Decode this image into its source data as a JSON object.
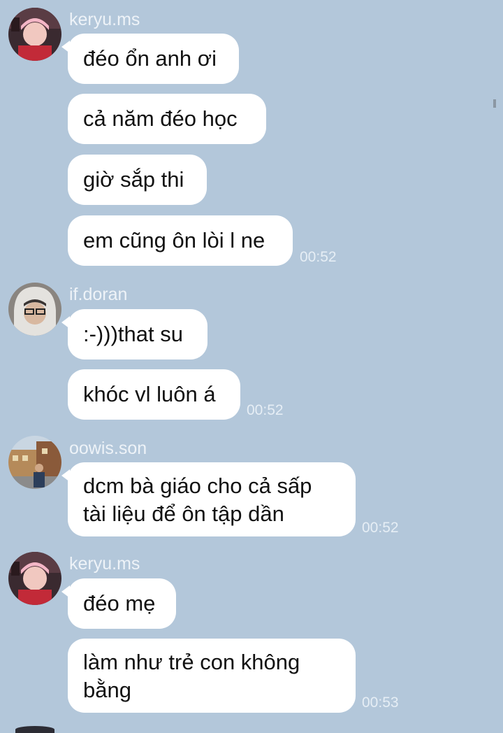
{
  "messages": [
    {
      "sender": "keryu.ms",
      "avatar": "avatar-keryu",
      "lines": [
        "đéo ổn anh ơi",
        "cả năm đéo học",
        "giờ sắp thi",
        "em cũng ôn lòi l ne"
      ],
      "time": "00:52"
    },
    {
      "sender": "if.doran",
      "avatar": "avatar-doran",
      "lines": [
        ":-)))that su",
        "khóc vl luôn á"
      ],
      "time": "00:52"
    },
    {
      "sender": "oowis.son",
      "avatar": "avatar-oowis",
      "lines": [
        "dcm bà giáo cho cả sấp\ntài liệu để ôn tập dần"
      ],
      "time": "00:52"
    },
    {
      "sender": "keryu.ms",
      "avatar": "avatar-keryu",
      "lines": [
        "đéo mẹ",
        "làm như trẻ con không\nbằng"
      ],
      "time": "00:53"
    }
  ],
  "colors": {
    "background": "#b3c7da",
    "bubble": "#ffffff",
    "text": "#111111"
  }
}
